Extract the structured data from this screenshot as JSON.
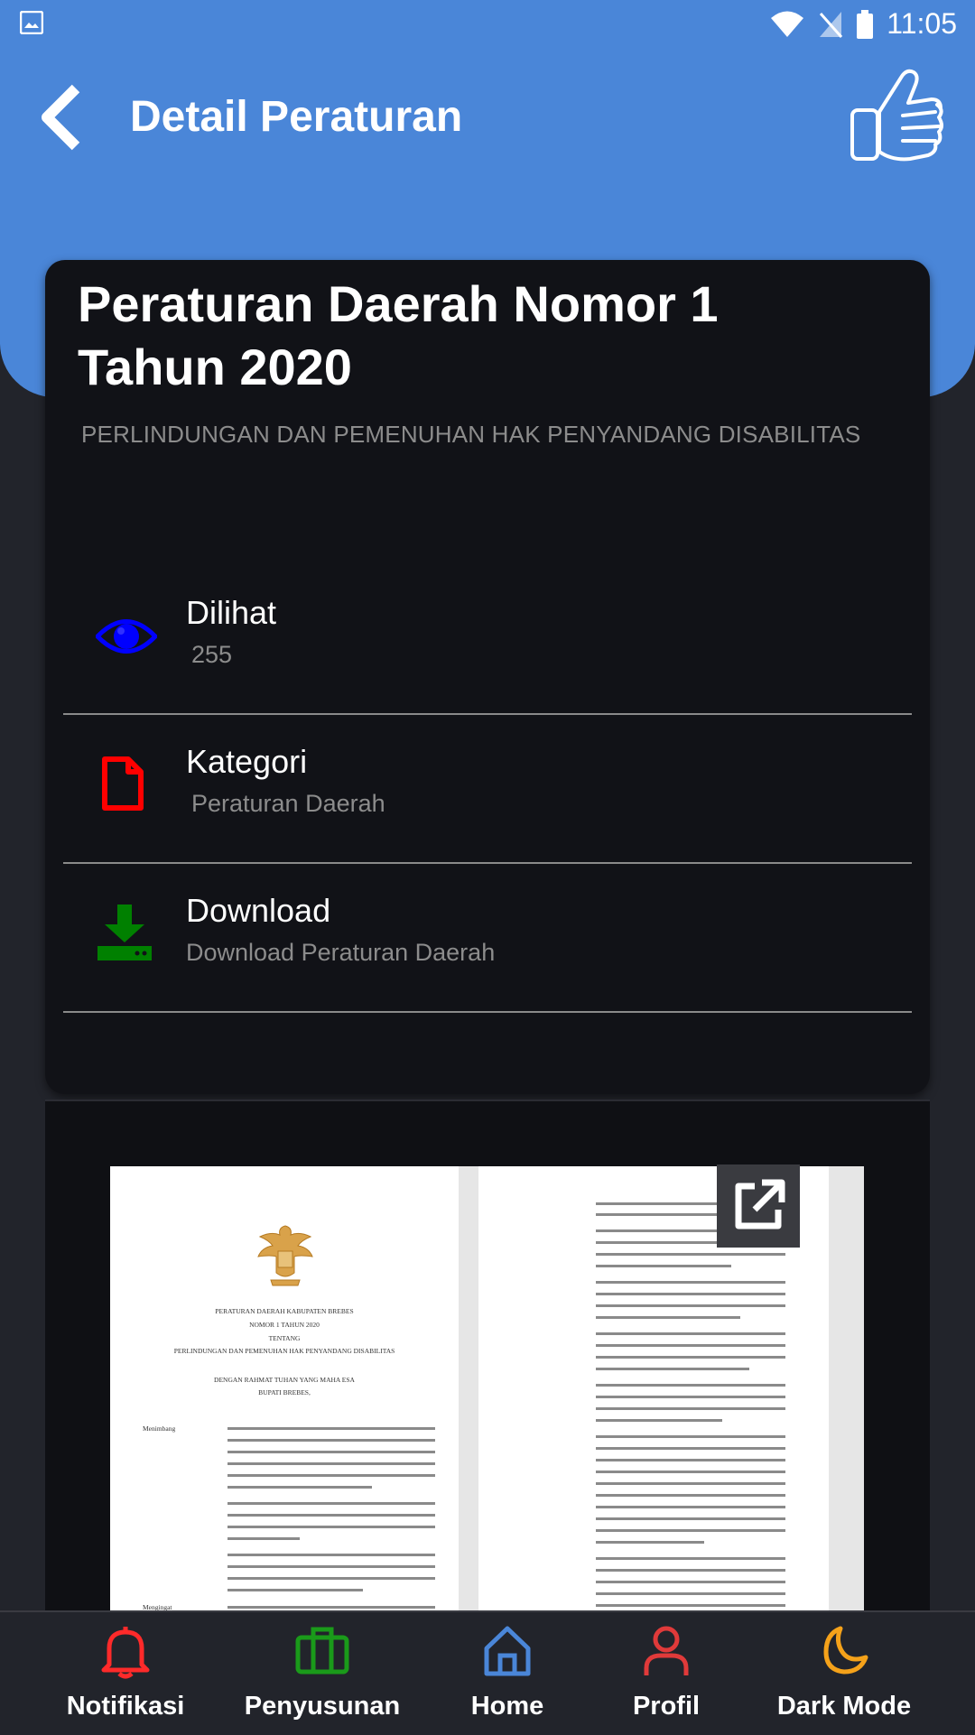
{
  "status_bar": {
    "time": "11:05"
  },
  "header": {
    "title": "Detail Peraturan"
  },
  "document": {
    "title": "Peraturan Daerah Nomor  1\nTahun 2020",
    "subtitle": "PERLINDUNGAN DAN PEMENUHAN HAK PENYANDANG DISABILITAS"
  },
  "info": [
    {
      "label": "Dilihat",
      "value": "255",
      "icon": "eye-icon",
      "color": "#0000ff"
    },
    {
      "label": "Kategori",
      "value": "Peraturan Daerah",
      "icon": "file-icon",
      "color": "#ff0000"
    },
    {
      "label": "Download",
      "value": "Download Peraturan Daerah",
      "icon": "download-icon",
      "color": "#008000"
    }
  ],
  "preview": {
    "heading_1": "PERATURAN DAERAH KABUPATEN BREBES",
    "heading_2": "NOMOR    1    TAHUN 2020",
    "heading_3": "TENTANG",
    "heading_4": "PERLINDUNGAN DAN PEMENUHAN HAK PENYANDANG DISABILITAS",
    "heading_5": "DENGAN RAHMAT TUHAN YANG MAHA ESA",
    "heading_6": "BUPATI BREBES,",
    "menimbang": "Menimbang",
    "mengingat": "Mengingat"
  },
  "nav": [
    {
      "label": "Notifikasi",
      "icon": "bell-icon",
      "color": "#ff2a2a"
    },
    {
      "label": "Penyusunan",
      "icon": "briefcase-icon",
      "color": "#1a9a1a"
    },
    {
      "label": "Home",
      "icon": "home-icon",
      "color": "#4a86d8"
    },
    {
      "label": "Profil",
      "icon": "person-icon",
      "color": "#e03a3a"
    },
    {
      "label": "Dark Mode",
      "icon": "moon-icon",
      "color": "#f5a21a"
    }
  ]
}
